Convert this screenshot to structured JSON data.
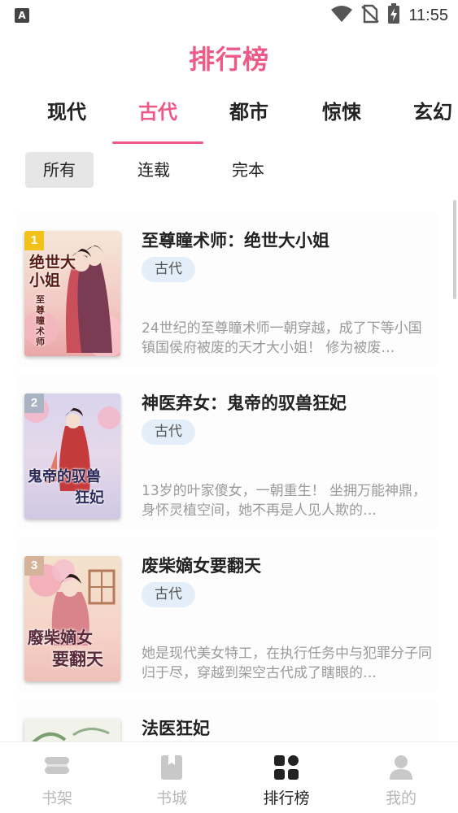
{
  "status_bar": {
    "notification_letter": "A",
    "time": "11:55"
  },
  "page": {
    "title": "排行榜"
  },
  "category_tabs": [
    {
      "label": "现代",
      "active": false
    },
    {
      "label": "古代",
      "active": true
    },
    {
      "label": "都市",
      "active": false
    },
    {
      "label": "惊悚",
      "active": false
    },
    {
      "label": "玄幻",
      "active": false
    }
  ],
  "status_filters": [
    {
      "label": "所有",
      "active": true
    },
    {
      "label": "连载",
      "active": false
    },
    {
      "label": "完本",
      "active": false
    }
  ],
  "books": [
    {
      "rank": "1",
      "title": "至尊瞳术师：绝世大小姐",
      "genre": "古代",
      "description": "24世纪的至尊瞳术师一朝穿越，成了下等小国镇国侯府被废的天才大小姐！ 修为被废…",
      "cover_text": "绝世大小姐",
      "cover_subtext": "至尊瞳术师",
      "badge_color": "#f2c21b"
    },
    {
      "rank": "2",
      "title": "神医弃女：鬼帝的驭兽狂妃",
      "genre": "古代",
      "description": "13岁的叶家傻女，一朝重生！ 坐拥万能神鼎，身怀灵植空间，她不再是人见人欺的…",
      "cover_text": "鬼帝的驭兽",
      "cover_subtext": "狂妃",
      "badge_color": "#a9b3c2"
    },
    {
      "rank": "3",
      "title": "废柴嫡女要翻天",
      "genre": "古代",
      "description": "她是现代美女特工，在执行任务中与犯罪分子同归于尽，穿越到架空古代成了瞎眼的…",
      "cover_text": "廢柴嫡女",
      "cover_subtext": "要翻天",
      "badge_color": "#d4b39a"
    },
    {
      "rank": "",
      "title": "法医狂妃",
      "genre": "",
      "description": "",
      "cover_text": "",
      "cover_subtext": "",
      "badge_color": ""
    }
  ],
  "bottom_nav": [
    {
      "label": "书架",
      "icon": "bookshelf-icon",
      "active": false
    },
    {
      "label": "书城",
      "icon": "bookstore-icon",
      "active": false
    },
    {
      "label": "排行榜",
      "icon": "ranking-grid-icon",
      "active": true
    },
    {
      "label": "我的",
      "icon": "profile-icon",
      "active": false
    }
  ],
  "colors": {
    "accent": "#ee5a88",
    "tag_background": "#e3eef8",
    "inactive_nav": "#b8b8b8"
  }
}
